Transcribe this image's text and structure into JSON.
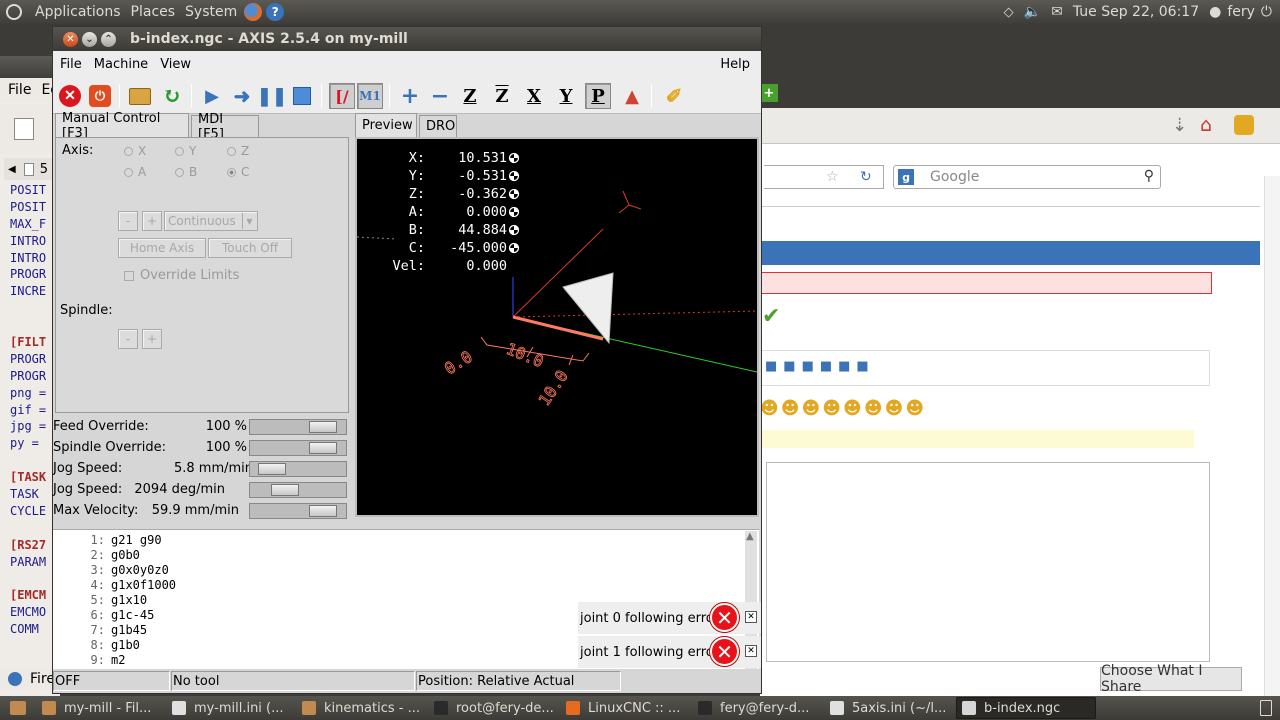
{
  "top_panel": {
    "menus": [
      "Applications",
      "Places",
      "System"
    ],
    "datetime": "Tue Sep 22, 06:17",
    "user": "fery"
  },
  "bg_editor": {
    "menu": [
      "File",
      "Ed"
    ],
    "tab_label": "5",
    "lines": [
      {
        "t": "POSIT",
        "style": "normal"
      },
      {
        "t": "POSIT",
        "style": "normal"
      },
      {
        "t": "MAX_F",
        "style": "normal"
      },
      {
        "t": "INTRO",
        "style": "normal"
      },
      {
        "t": "INTRO",
        "style": "normal"
      },
      {
        "t": "PROGR",
        "style": "normal"
      },
      {
        "t": "INCRE",
        "style": "normal"
      },
      {
        "t": "",
        "style": "normal"
      },
      {
        "t": "",
        "style": "normal"
      },
      {
        "t": "[FILT",
        "style": "red"
      },
      {
        "t": "PROGR",
        "style": "normal"
      },
      {
        "t": "PROGR",
        "style": "normal"
      },
      {
        "t": "png =",
        "style": "normal"
      },
      {
        "t": "gif =",
        "style": "normal"
      },
      {
        "t": "jpg =",
        "style": "normal"
      },
      {
        "t": "py =",
        "style": "normal"
      },
      {
        "t": "",
        "style": "normal"
      },
      {
        "t": "[TASK",
        "style": "red"
      },
      {
        "t": "TASK",
        "style": "normal"
      },
      {
        "t": "CYCLE",
        "style": "normal"
      },
      {
        "t": "",
        "style": "normal"
      },
      {
        "t": "[RS27",
        "style": "red"
      },
      {
        "t": "PARAM",
        "style": "normal"
      },
      {
        "t": "",
        "style": "normal"
      },
      {
        "t": "[EMCM",
        "style": "red"
      },
      {
        "t": "EMCMO",
        "style": "normal"
      },
      {
        "t": "COMM",
        "style": "normal"
      }
    ],
    "status_text": "Fire"
  },
  "bg_browser": {
    "search_placeholder": "Google",
    "share_button": "Choose What I Share"
  },
  "axis": {
    "title": "b-index.ngc - AXIS 2.5.4 on my-mill",
    "menu": {
      "file": "File",
      "machine": "Machine",
      "view": "View",
      "help": "Help"
    },
    "tabs": {
      "manual": "Manual Control [F3]",
      "mdi": "MDI [F5]",
      "preview": "Preview",
      "dro": "DRO"
    },
    "manual": {
      "axis_label": "Axis:",
      "axes": [
        "X",
        "Y",
        "Z",
        "A",
        "B",
        "C"
      ],
      "selected_axis": "C",
      "minus": "-",
      "plus": "+",
      "jog_mode": "Continuous",
      "home_axis": "Home Axis",
      "touch_off": "Touch Off",
      "override_limits": "Override Limits",
      "spindle_label": "Spindle:"
    },
    "overrides": [
      {
        "name": "Feed Override:",
        "value": "100 %",
        "position": 0.9
      },
      {
        "name": "Spindle Override:",
        "value": "100 %",
        "position": 0.9
      },
      {
        "name": "Jog Speed:",
        "value": "5.8 mm/min",
        "position": 0.12
      },
      {
        "name": "Jog Speed:",
        "value": "2094 deg/min",
        "position": 0.32
      },
      {
        "name": "Max Velocity:",
        "value": "59.9 mm/min",
        "position": 0.9
      }
    ],
    "dro": [
      {
        "axis": "X:",
        "value": "10.531",
        "homed": true
      },
      {
        "axis": "Y:",
        "value": "-0.531",
        "homed": true
      },
      {
        "axis": "Z:",
        "value": "-0.362",
        "homed": true
      },
      {
        "axis": "A:",
        "value": "0.000",
        "homed": true
      },
      {
        "axis": "B:",
        "value": "44.884",
        "homed": true
      },
      {
        "axis": "C:",
        "value": "-45.000",
        "homed": true
      },
      {
        "axis": "Vel:",
        "value": "0.000",
        "homed": false
      }
    ],
    "grid_labels": [
      "0.0",
      "10.0",
      "10.0"
    ],
    "gcode": [
      {
        "n": "1:",
        "code": "g21 g90"
      },
      {
        "n": "2:",
        "code": "g0b0"
      },
      {
        "n": "3:",
        "code": "g0x0y0z0"
      },
      {
        "n": "4:",
        "code": "g1x0f1000"
      },
      {
        "n": "5:",
        "code": "g1x10"
      },
      {
        "n": "6:",
        "code": "g1c-45"
      },
      {
        "n": "7:",
        "code": "g1b45"
      },
      {
        "n": "8:",
        "code": "g1b0"
      },
      {
        "n": "9:",
        "code": "m2"
      }
    ],
    "errors": [
      "joint 0 following error",
      "joint 1 following error"
    ],
    "status": {
      "state": "OFF",
      "tool": "No tool",
      "position": "Position: Relative Actual"
    }
  },
  "taskbar": [
    {
      "label": "my-mill - Fil...",
      "color": "#c08a50",
      "active": false
    },
    {
      "label": "my-mill.ini (...",
      "color": "#e0e0e0",
      "active": false
    },
    {
      "label": "kinematics - ...",
      "color": "#c08a50",
      "active": false
    },
    {
      "label": "root@fery-de...",
      "color": "#2a2a2a",
      "active": false
    },
    {
      "label": "LinuxCNC :: ...",
      "color": "#e76b1e",
      "active": false
    },
    {
      "label": "fery@fery-d...",
      "color": "#2a2a2a",
      "active": false
    },
    {
      "label": "5axis.ini (~/l...",
      "color": "#e0e0e0",
      "active": false
    },
    {
      "label": "b-index.ngc",
      "color": "#d6d6d6",
      "active": true
    }
  ],
  "colors": {
    "accent_blue": "#3b73b9",
    "error_red": "#e8121a",
    "dro_white": "#ffffff"
  }
}
